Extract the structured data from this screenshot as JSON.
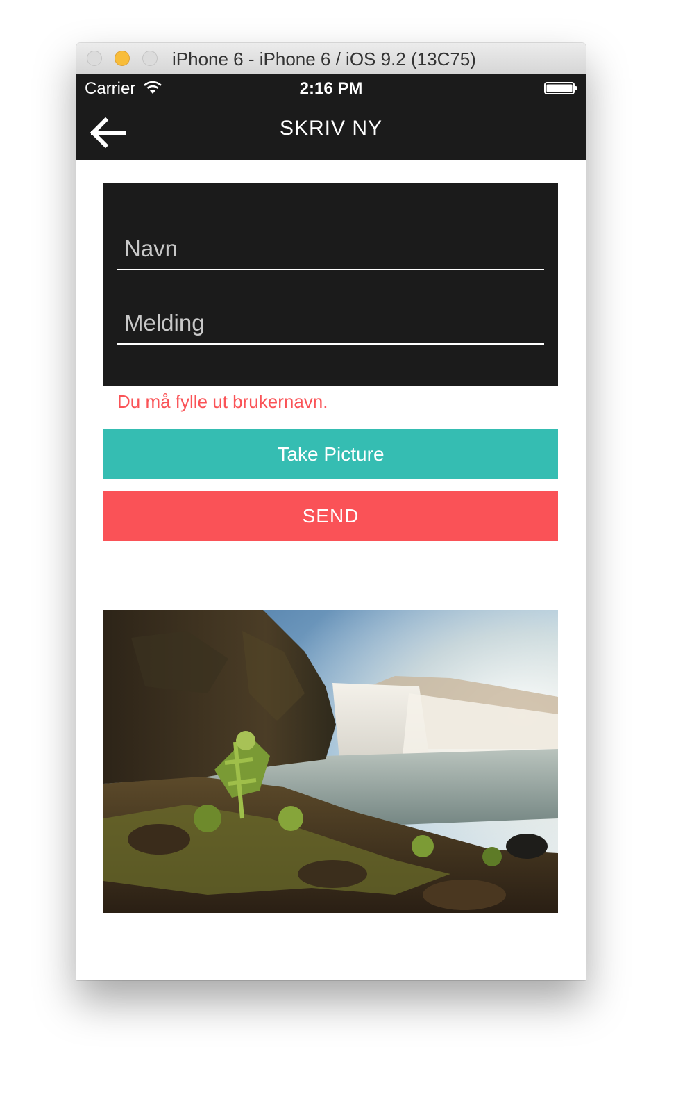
{
  "window": {
    "title": "iPhone 6 - iPhone 6 / iOS 9.2 (13C75)"
  },
  "status_bar": {
    "carrier": "Carrier",
    "time": "2:16 PM",
    "wifi_icon": "wifi-icon",
    "battery_icon": "battery-icon"
  },
  "nav_bar": {
    "title": "SKRIV NY",
    "back_icon": "arrow-left-icon"
  },
  "form": {
    "name_placeholder": "Navn",
    "name_value": "",
    "message_placeholder": "Melding",
    "message_value": "",
    "error": "Du må fylle ut brukernavn."
  },
  "buttons": {
    "take_picture": "Take Picture",
    "send": "SEND"
  },
  "colors": {
    "bar_background": "#1b1b1b",
    "take_picture": "#35bdb2",
    "send": "#fa5257",
    "error_text": "#fa5357"
  }
}
